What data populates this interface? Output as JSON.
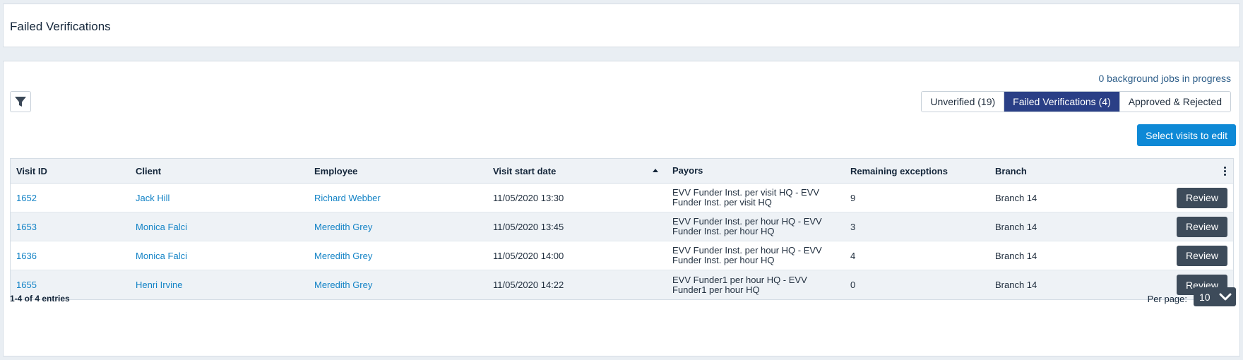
{
  "header": {
    "title": "Failed Verifications"
  },
  "toolbar": {
    "background_jobs": "0 background jobs in progress",
    "filter_icon": "filter-icon",
    "tabs": [
      {
        "label": "Unverified (19)",
        "active": false
      },
      {
        "label": "Failed Verifications (4)",
        "active": true
      },
      {
        "label": "Approved & Rejected",
        "active": false
      }
    ],
    "select_visits_label": "Select visits to edit"
  },
  "table": {
    "columns": {
      "visit_id": "Visit ID",
      "client": "Client",
      "employee": "Employee",
      "visit_start_date": "Visit start date",
      "payors": "Payors",
      "remaining_exceptions": "Remaining exceptions",
      "branch": "Branch"
    },
    "sort_icon": "sort-ascending-icon",
    "menu_icon": "kebab-menu-icon",
    "review_label": "Review",
    "rows": [
      {
        "visit_id": "1652",
        "client": "Jack Hill",
        "employee": "Richard Webber",
        "date": "11/05/2020 13:30",
        "payors": "EVV Funder Inst. per visit HQ - EVV Funder Inst. per visit HQ",
        "remaining": "9",
        "branch": "Branch 14"
      },
      {
        "visit_id": "1653",
        "client": "Monica Falci",
        "employee": "Meredith Grey",
        "date": "11/05/2020 13:45",
        "payors": "EVV Funder Inst. per hour HQ - EVV Funder Inst. per hour HQ",
        "remaining": "3",
        "branch": "Branch 14"
      },
      {
        "visit_id": "1636",
        "client": "Monica Falci",
        "employee": "Meredith Grey",
        "date": "11/05/2020 14:00",
        "payors": "EVV Funder Inst. per hour HQ - EVV Funder Inst. per hour HQ",
        "remaining": "4",
        "branch": "Branch 14"
      },
      {
        "visit_id": "1655",
        "client": "Henri Irvine",
        "employee": "Meredith Grey",
        "date": "11/05/2020 14:22",
        "payors": "EVV Funder1 per hour HQ - EVV Funder1 per hour HQ",
        "remaining": "0",
        "branch": "Branch 14"
      }
    ]
  },
  "footer": {
    "entries": "1-4 of 4 entries",
    "per_page_label": "Per page:",
    "per_page_value": "10",
    "chevron_icon": "chevron-down-icon"
  }
}
